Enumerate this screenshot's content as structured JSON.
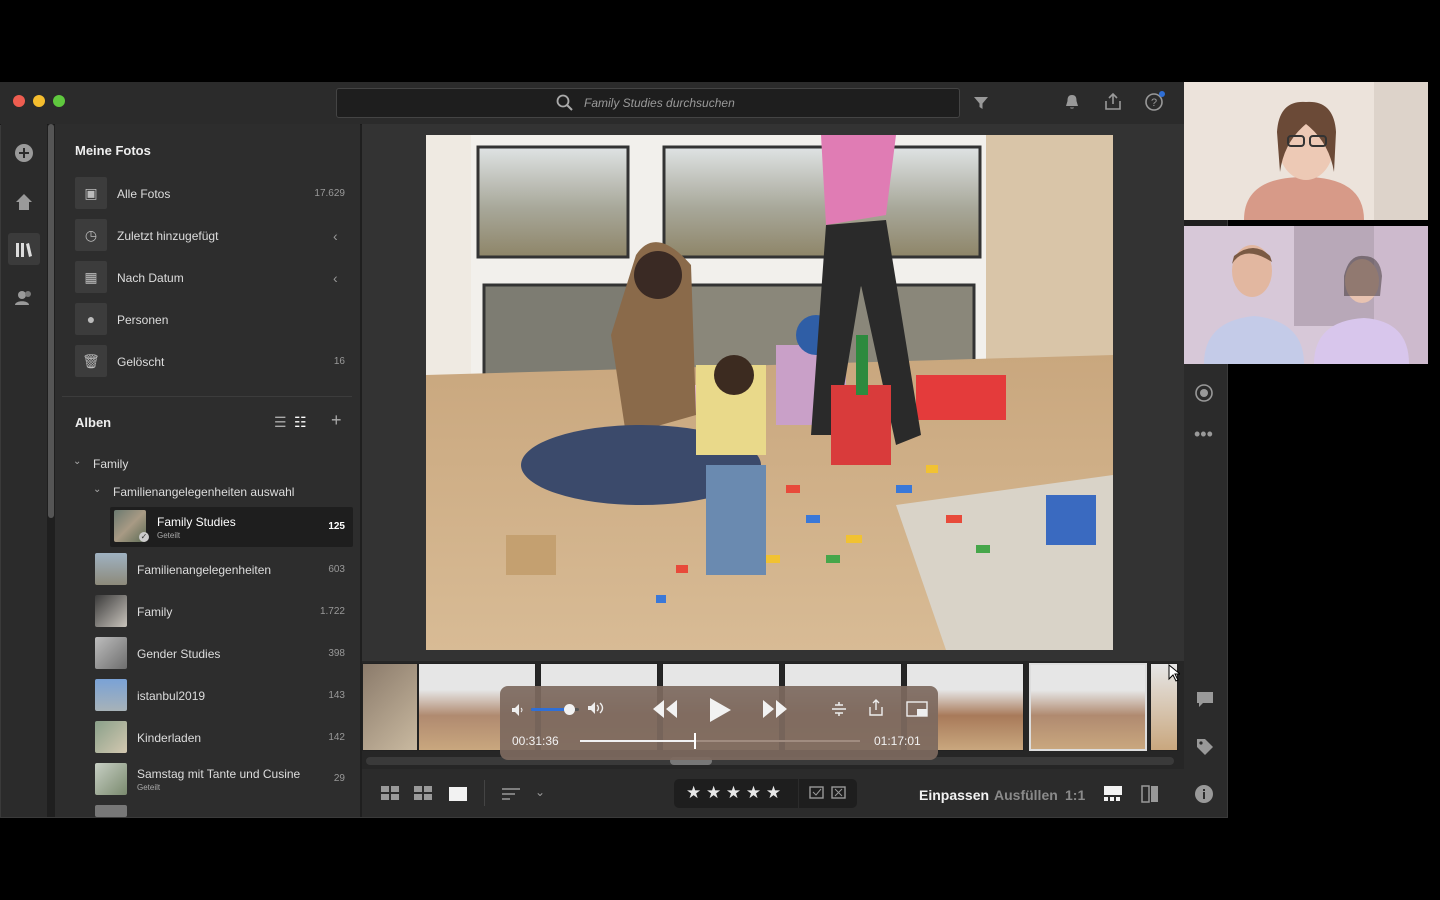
{
  "search": {
    "placeholder": "Family Studies durchsuchen"
  },
  "sidebar": {
    "meine_fotos_title": "Meine Fotos",
    "nav": [
      {
        "label": "Alle Fotos",
        "count": "17.629",
        "icon": "photos-icon"
      },
      {
        "label": "Zuletzt hinzugefügt",
        "count": "",
        "icon": "clock-icon"
      },
      {
        "label": "Nach Datum",
        "count": "",
        "icon": "calendar-icon"
      },
      {
        "label": "Personen",
        "count": "",
        "icon": "person-icon"
      },
      {
        "label": "Gelöscht",
        "count": "16",
        "icon": "trash-icon"
      }
    ],
    "alben_title": "Alben",
    "folder_family": "Family",
    "folder_sub": "Familienangelegenheiten auswahl",
    "selected_album": {
      "name": "Family Studies",
      "sub": "Geteilt",
      "count": "125"
    },
    "albums": [
      {
        "name": "Familienangelegenheiten",
        "sub": "",
        "count": "603"
      },
      {
        "name": "Family",
        "sub": "",
        "count": "1.722"
      },
      {
        "name": "Gender Studies",
        "sub": "",
        "count": "398"
      },
      {
        "name": "istanbul2019",
        "sub": "",
        "count": "143"
      },
      {
        "name": "Kinderladen",
        "sub": "",
        "count": "142"
      },
      {
        "name": "Samstag mit Tante  und Cusine",
        "sub": "Geteilt",
        "count": "29"
      }
    ]
  },
  "player": {
    "elapsed": "00:31:36",
    "total": "01:17:01",
    "progress": 0.41,
    "volume": 0.8
  },
  "bottombar": {
    "fit": "Einpassen",
    "fill": "Ausfüllen",
    "ratio": "1:1",
    "stars": "★ ★ ★ ★ ★"
  },
  "colors": {
    "accent": "#2f6fd6",
    "sidebar_bg": "#2d2d2d",
    "selected_row": "#1e1e1e"
  }
}
